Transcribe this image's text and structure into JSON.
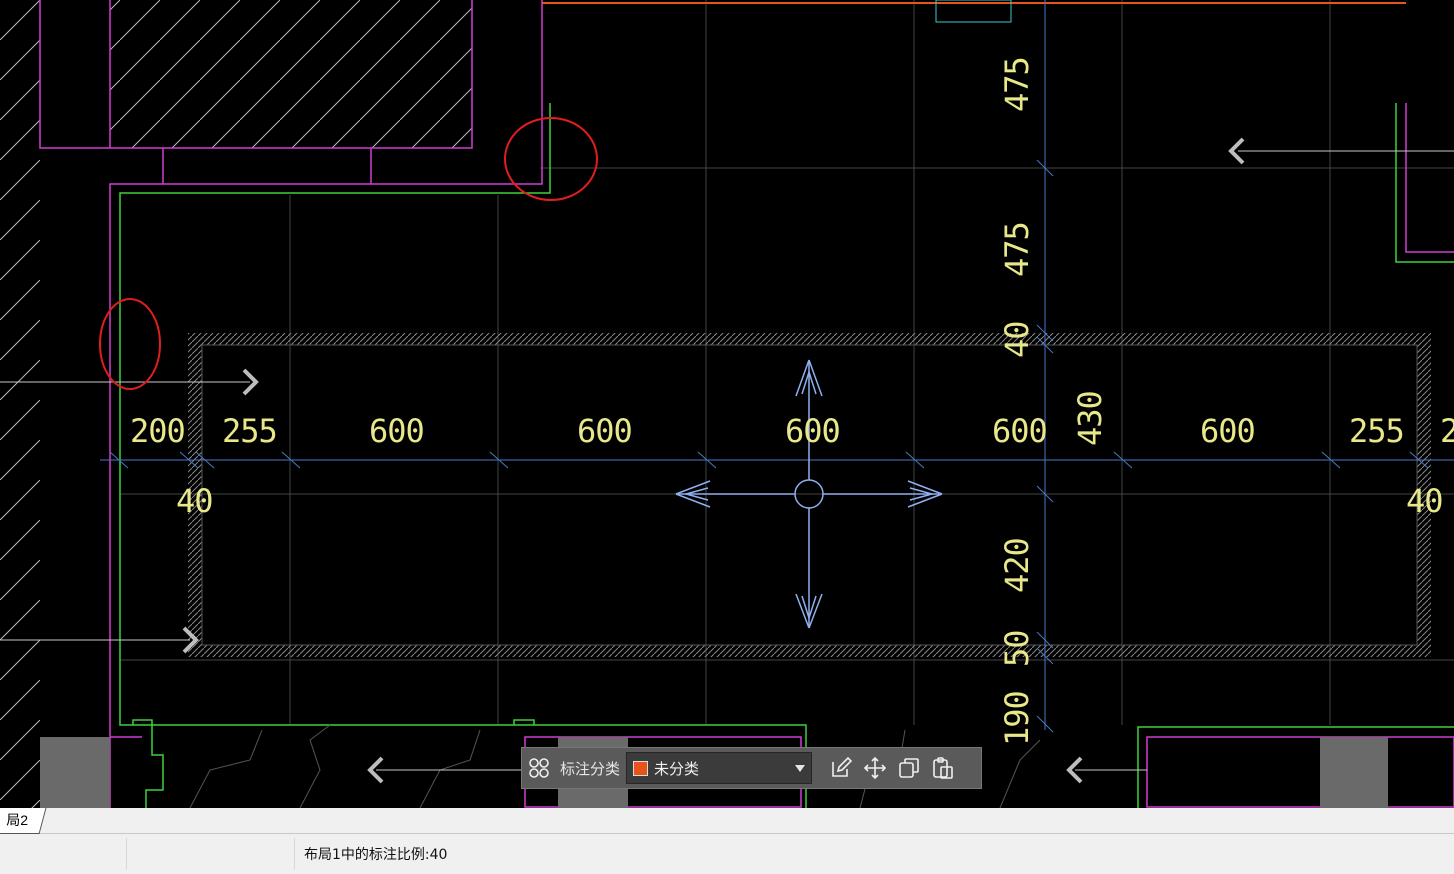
{
  "drawing": {
    "dimensions_top": [
      "200",
      "255",
      "600",
      "600",
      "600",
      "600",
      "600",
      "255",
      "2"
    ],
    "dimensions_side": [
      "40",
      "40"
    ],
    "dimensions_vertical": [
      "475",
      "475",
      "40",
      "430",
      "420",
      "50",
      "190"
    ]
  },
  "toolbar": {
    "group_label": "标注分类",
    "selected_value": "未分类",
    "swatch_color": "#e8531c"
  },
  "tabs": {
    "active_label": "局2"
  },
  "status": {
    "message": "布局1中的标注比例:40"
  },
  "colors": {
    "magenta_walls": "#d23cd2",
    "green_outline": "#3cd23c",
    "dimension_text": "#e8e88a",
    "blue_lines": "#4a78c8",
    "highlight_circles": "#e01e1e"
  }
}
